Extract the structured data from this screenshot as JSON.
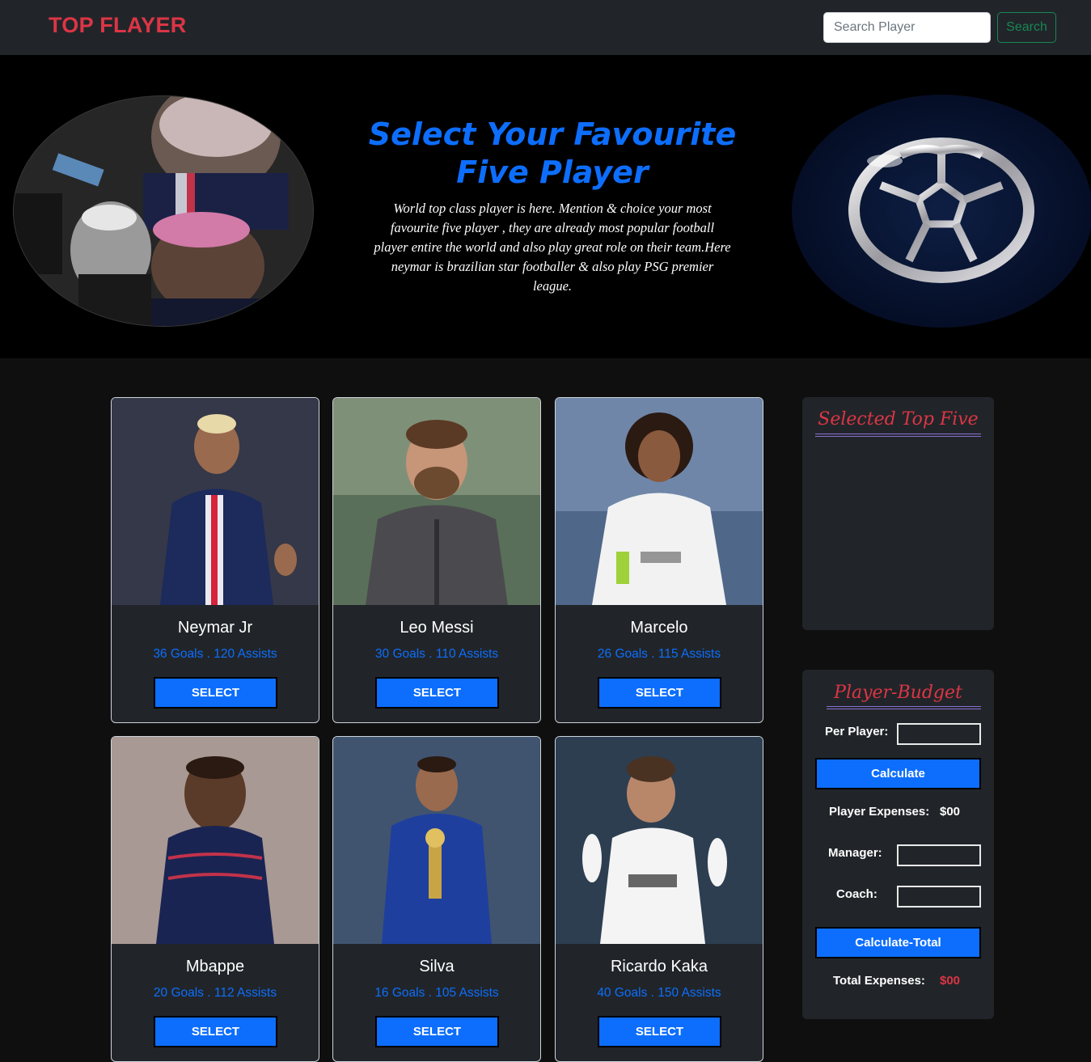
{
  "navbar": {
    "brand": "TOP FLAYER",
    "search_placeholder": "Search Player",
    "search_label": "Search"
  },
  "hero": {
    "title": "Select Your Favourite Five Player",
    "description": "World top class player is here. Mention & choice your most favourite five player , they are already most popular football player entire the world and also play great role on their team.Here neymar is brazilian star footballer & also play PSG premier league."
  },
  "players": [
    {
      "name": "Neymar Jr",
      "stats": "36 Goals . 120 Assists",
      "select_label": "SELECT",
      "kit": "#1c2a5c"
    },
    {
      "name": "Leo Messi",
      "stats": "30 Goals . 110 Assists",
      "select_label": "SELECT",
      "kit": "#4b4b4f"
    },
    {
      "name": "Marcelo",
      "stats": "26 Goals . 115 Assists",
      "select_label": "SELECT",
      "kit": "#f2f2f2"
    },
    {
      "name": "Mbappe",
      "stats": "20 Goals . 112 Assists",
      "select_label": "SELECT",
      "kit": "#1a2452"
    },
    {
      "name": "Silva",
      "stats": "16 Goals . 105 Assists",
      "select_label": "SELECT",
      "kit": "#1f3f9e"
    },
    {
      "name": "Ricardo Kaka",
      "stats": "40 Goals . 150 Assists",
      "select_label": "SELECT",
      "kit": "#f4f4f4"
    }
  ],
  "selected_panel": {
    "title": "Selected Top Five"
  },
  "budget": {
    "title": "Player-Budget",
    "per_player_label": "Per Player:",
    "calculate_label": "Calculate",
    "player_expenses_label": "Player Expenses:",
    "player_expenses_value": "$00",
    "manager_label": "Manager:",
    "coach_label": "Coach:",
    "calculate_total_label": "Calculate-Total",
    "total_expenses_label": "Total Expenses:",
    "total_expenses_value": "$00"
  },
  "colors": {
    "accent": "#0d6efd",
    "brand": "#dc3545",
    "success": "#198754"
  }
}
